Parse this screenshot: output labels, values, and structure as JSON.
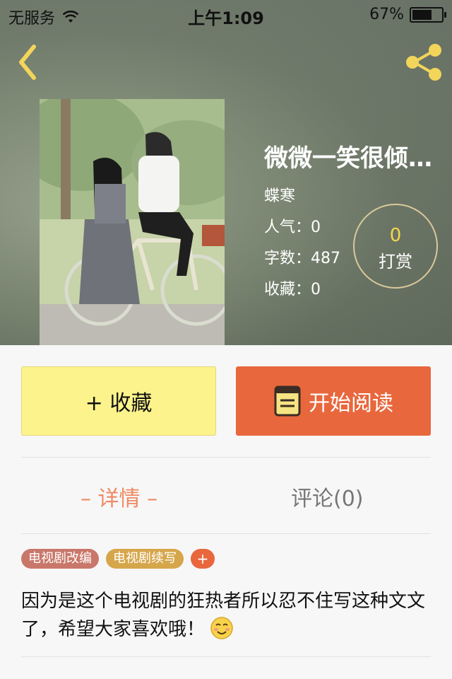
{
  "status": {
    "carrier": "无服务",
    "time": "上午1:09",
    "battery": "67%",
    "battery_level": 0.67
  },
  "book": {
    "title": "微微一笑很倾…",
    "author": "蝶寒",
    "stats": [
      "人气：0",
      "字数：487",
      "收藏：0"
    ]
  },
  "reward": {
    "count": "0",
    "label": "打赏"
  },
  "actions": {
    "collect": "+ 收藏",
    "read": "开始阅读"
  },
  "tabs": {
    "detail": "– 详情 –",
    "comments": "评论(0)"
  },
  "tags": [
    "电视剧改编",
    "电视剧续写"
  ],
  "tag_add": "+",
  "description": "因为是这个电视剧的狂热者所以忍不住写这种文文了，希望大家喜欢哦！",
  "colors": {
    "accent_orange": "#e8673d",
    "collect_yellow": "#fdf38c",
    "tab_active": "#ef8a63"
  }
}
